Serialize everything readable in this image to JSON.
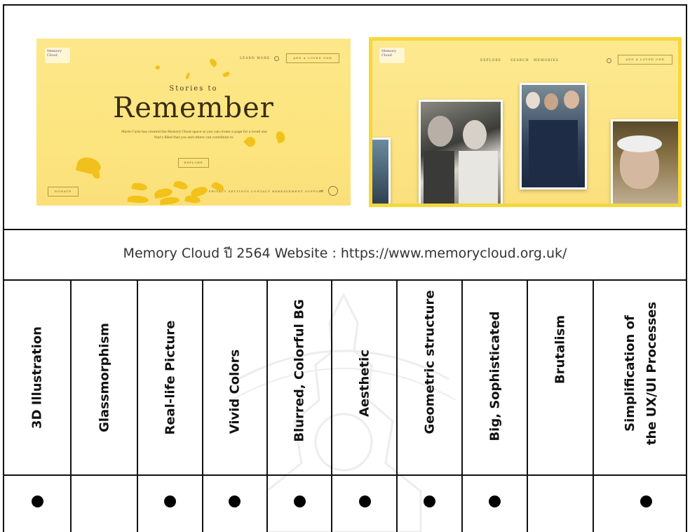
{
  "screenshot_left": {
    "logo": "Memory Cloud",
    "nav_learn_more": "LEARN MORE",
    "nav_add_button": "ADD A LOVED ONE",
    "hero_subtitle": "Stories to",
    "hero_title": "Remember",
    "hero_body": "Marie Curie has created the Memory Cloud space so you can create a page for a loved one that's filled that you and others can contribute to.",
    "explore_button": "EXPLORE",
    "donate_button": "DONATE",
    "footer_links": "PRIVACY SETTINGS   CONTACT   BEREAVEMENT SUPPORT"
  },
  "screenshot_right": {
    "logo": "Memory Cloud",
    "nav_items": [
      "EXPLORE",
      "SEARCH",
      "MEMORIES"
    ],
    "nav_add_button": "ADD A LOVED ONE",
    "frame_color": "#f6d73a"
  },
  "caption": "Memory Cloud ปี 2564 Website : https://www.memorycloud.org.uk/",
  "columns": [
    {
      "label": "3D Illustration",
      "checked": true
    },
    {
      "label": "Glassmorphism",
      "checked": false
    },
    {
      "label": "Real-life Picture",
      "checked": true
    },
    {
      "label": "Vivid Colors",
      "checked": true
    },
    {
      "label": "Blurred, Colorful BG",
      "checked": true
    },
    {
      "label": "Aesthetic",
      "checked": true
    },
    {
      "label": "Geometric structure",
      "checked": true
    },
    {
      "label": "Big, Sophisticated",
      "checked": true
    },
    {
      "label": "Brutalism",
      "checked": false
    },
    {
      "label_line1": "Simplification of",
      "label_line2": "the UX/UI Processes",
      "checked": true
    }
  ],
  "dot_symbol": "●"
}
